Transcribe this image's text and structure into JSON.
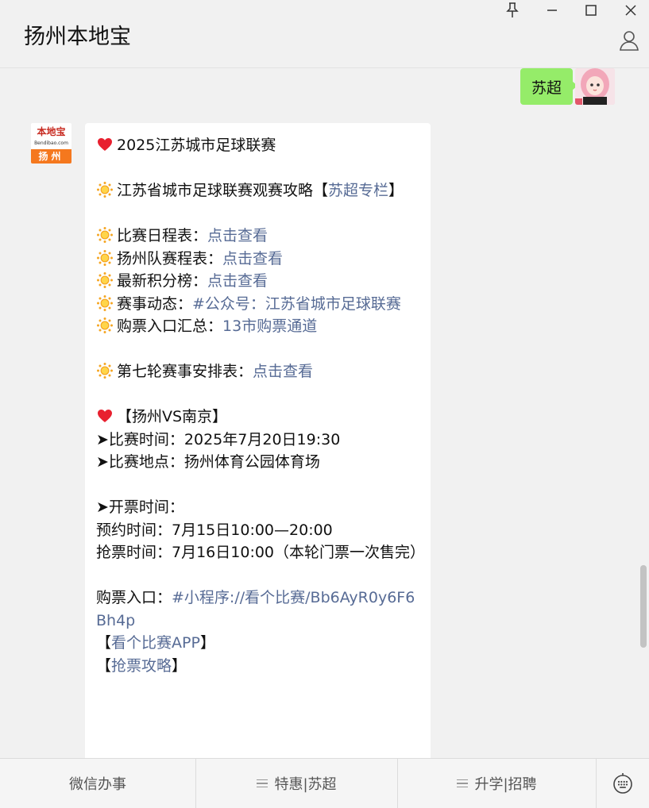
{
  "header": {
    "title": "扬州本地宝",
    "icons": [
      "pin-icon",
      "minimize-icon",
      "maximize-icon",
      "close-icon",
      "user-icon"
    ]
  },
  "my_message": {
    "text": "苏超"
  },
  "bot": {
    "avatar": {
      "logo_text": "本地宝",
      "logo_url": "Bendibao.com",
      "city": "扬州"
    }
  },
  "article": {
    "title": "2025江苏城市足球联赛",
    "guide_prefix": "江苏省城市足球联赛观赛攻略【",
    "guide_link": "苏超专栏",
    "guide_suffix": "】",
    "items": [
      {
        "label": "比赛日程表：",
        "link": "点击查看"
      },
      {
        "label": "扬州队赛程表：",
        "link": "点击查看"
      },
      {
        "label": "最新积分榜：",
        "link": "点击查看"
      },
      {
        "label": "赛事动态：",
        "link": "#公众号：江苏省城市足球联赛"
      },
      {
        "label": "购票入口汇总：",
        "link": "13市购票通道"
      }
    ],
    "round7": {
      "label": "第七轮赛事安排表：",
      "link": "点击查看"
    },
    "match_title": "【扬州VS南京】",
    "match_time": "➤比赛时间：2025年7月20日19:30",
    "match_venue": "➤比赛地点：扬州体育公园体育场",
    "ticket_heading": "➤开票时间：",
    "reserve_time": "预约时间：7月15日10:00—20:00",
    "grab_time": "抢票时间：7月16日10:00（本轮门票一次售完）",
    "buy_prefix": "购票入口：",
    "buy_link": "#小程序://看个比赛/Bb6AyR0y6F6Bh4p",
    "app_prefix": "【",
    "app_link": "看个比赛APP",
    "app_suffix": "】",
    "strategy_prefix": "【",
    "strategy_link": "抢票攻略",
    "strategy_suffix": "】"
  },
  "bottom_bar": {
    "tabs": [
      "微信办事",
      "特惠|苏超",
      "升学|招聘"
    ],
    "keyboard_icon": "keyboard-icon"
  },
  "colors": {
    "link": "#576b95",
    "my_bubble": "#95ec69",
    "background": "#f1f1f1",
    "logo_orange": "#f5781e"
  }
}
